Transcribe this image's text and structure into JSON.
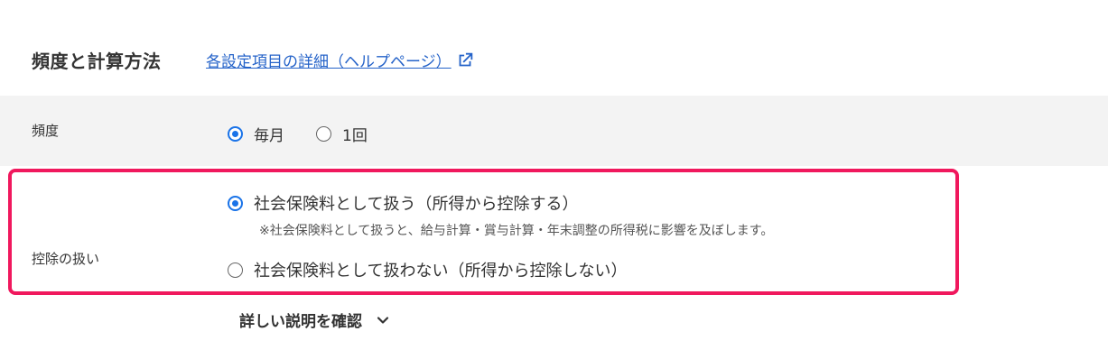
{
  "section": {
    "title": "頻度と計算方法",
    "help_link": "各設定項目の詳細（ヘルプページ）"
  },
  "frequency": {
    "label": "頻度",
    "options": [
      {
        "label": "毎月",
        "checked": true
      },
      {
        "label": "1回",
        "checked": false
      }
    ]
  },
  "deduction": {
    "label": "控除の扱い",
    "options": [
      {
        "label": "社会保険料として扱う（所得から控除する）",
        "checked": true
      },
      {
        "label": "社会保険料として扱わない（所得から控除しない）",
        "checked": false
      }
    ],
    "note": "※社会保険料として扱うと、給与計算・賞与計算・年末調整の所得税に影響を及ぼします。",
    "highlight_color": "#f0185d"
  },
  "details": {
    "label": "詳しい説明を確認"
  },
  "colors": {
    "accent": "#1a73e8",
    "link": "#2563c9",
    "row_bg": "#f3f3f3"
  },
  "icons": {
    "help_link_icon": "external-link-icon",
    "details_icon": "chevron-down-icon"
  }
}
